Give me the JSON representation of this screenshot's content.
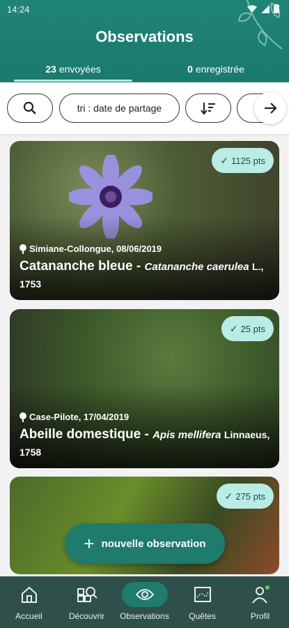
{
  "status": {
    "time": "14:24"
  },
  "header": {
    "title": "Observations"
  },
  "tabs": [
    {
      "count": "23",
      "label": "envoyées"
    },
    {
      "count": "0",
      "label": "enregistrée"
    }
  ],
  "filters": {
    "sort_label": "tri : date de partage"
  },
  "observations": [
    {
      "points": "1125 pts",
      "place_date": "Simiane-Collongue, 08/06/2019",
      "common": "Catananche bleue",
      "sci": "Catananche caerulea",
      "author": "L., 1753"
    },
    {
      "points": "25 pts",
      "place_date": "Case-Pilote, 17/04/2019",
      "common": "Abeille domestique",
      "sci": "Apis mellifera",
      "author": "Linnaeus, 1758"
    },
    {
      "points": "275 pts"
    }
  ],
  "fab": {
    "label": "nouvelle observation"
  },
  "nav": [
    {
      "label": "Accueil"
    },
    {
      "label": "Découvrir"
    },
    {
      "label": "Observations"
    },
    {
      "label": "Quêtes"
    },
    {
      "label": "Profil"
    }
  ],
  "colors": {
    "primary": "#1f8476",
    "accent": "#b8ece5",
    "nav_bg": "#2f4f4b"
  }
}
